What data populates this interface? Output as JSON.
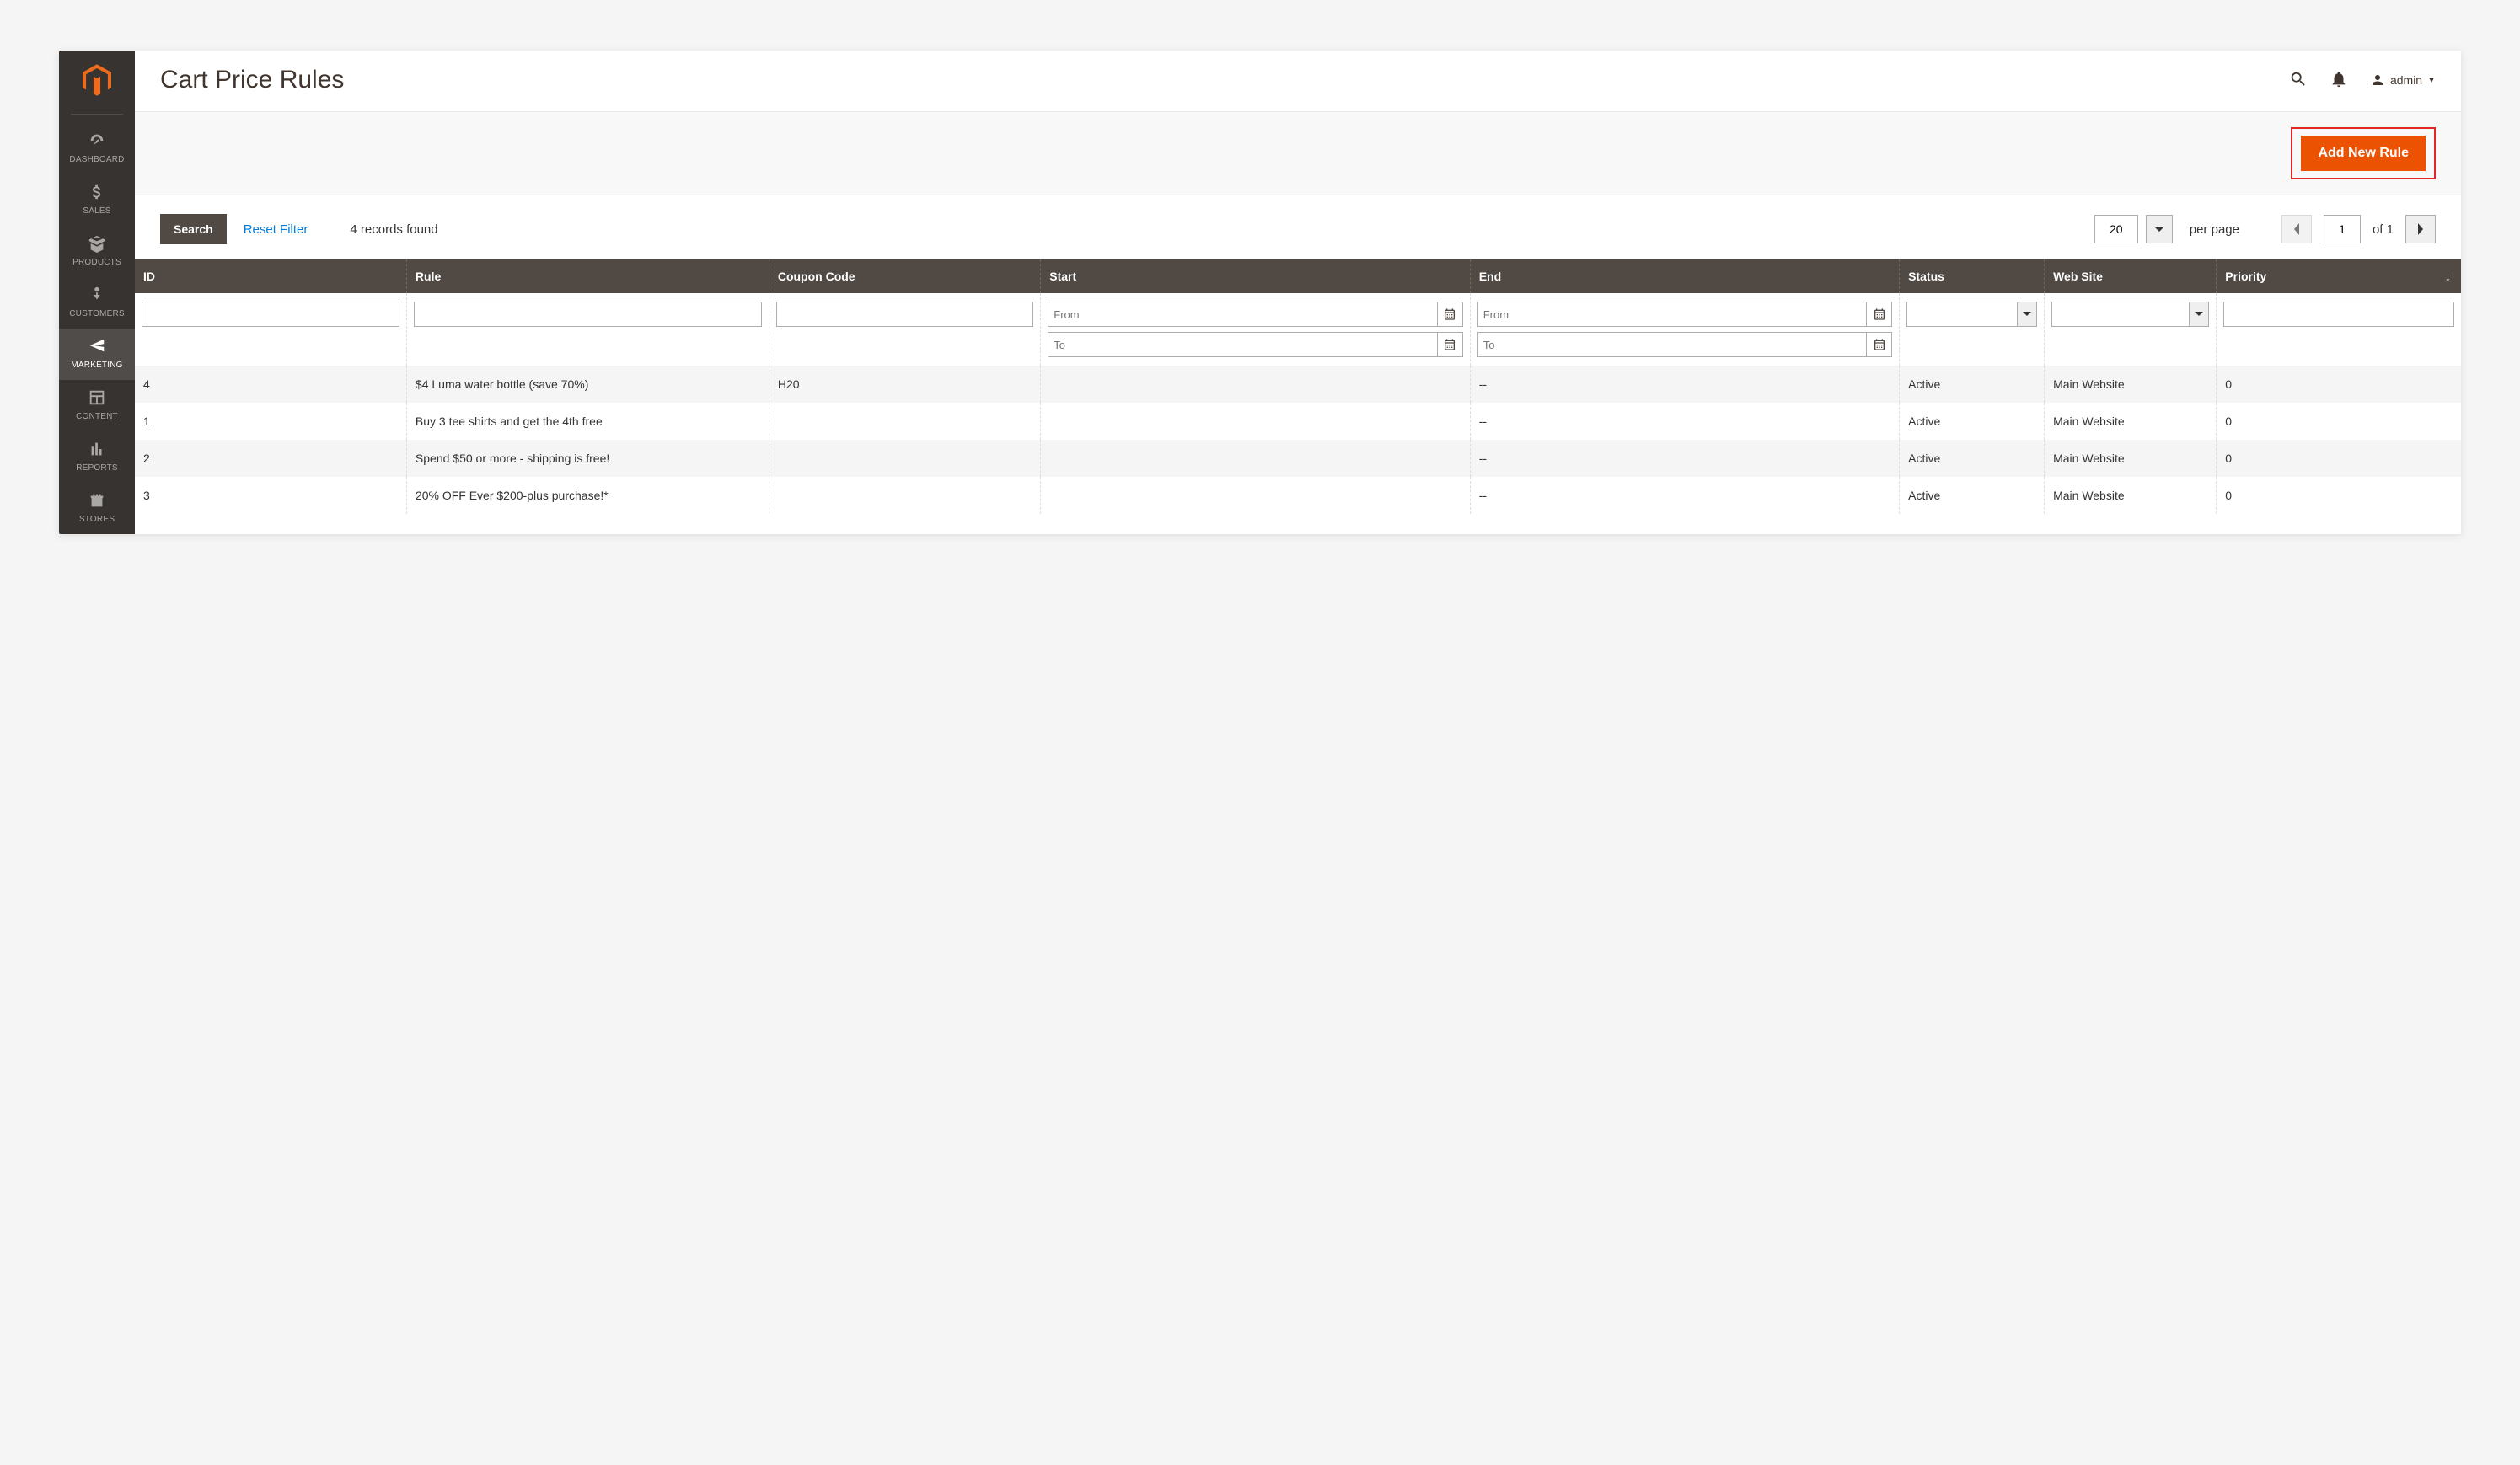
{
  "sidebar": {
    "items": [
      {
        "label": "DASHBOARD",
        "name": "nav-dashboard"
      },
      {
        "label": "SALES",
        "name": "nav-sales"
      },
      {
        "label": "PRODUCTS",
        "name": "nav-products"
      },
      {
        "label": "CUSTOMERS",
        "name": "nav-customers"
      },
      {
        "label": "MARKETING",
        "name": "nav-marketing",
        "active": true
      },
      {
        "label": "CONTENT",
        "name": "nav-content"
      },
      {
        "label": "REPORTS",
        "name": "nav-reports"
      },
      {
        "label": "STORES",
        "name": "nav-stores"
      }
    ]
  },
  "header": {
    "title": "Cart Price Rules",
    "account_label": "admin"
  },
  "actionbar": {
    "add_button": "Add New Rule"
  },
  "toolbar": {
    "search_label": "Search",
    "reset_label": "Reset Filter",
    "records_found": "4 records found",
    "page_size": "20",
    "per_page_label": "per page",
    "current_page": "1",
    "of_label": "of 1"
  },
  "columns": {
    "id": "ID",
    "rule": "Rule",
    "coupon": "Coupon Code",
    "start": "Start",
    "end": "End",
    "status": "Status",
    "website": "Web Site",
    "priority": "Priority"
  },
  "filters": {
    "from_placeholder": "From",
    "to_placeholder": "To"
  },
  "rows": [
    {
      "id": "4",
      "rule": "$4 Luma water bottle (save 70%)",
      "coupon": "H20",
      "start": "",
      "end": "--",
      "status": "Active",
      "website": "Main Website",
      "priority": "0"
    },
    {
      "id": "1",
      "rule": "Buy 3 tee shirts and get the 4th free",
      "coupon": "",
      "start": "",
      "end": "--",
      "status": "Active",
      "website": "Main Website",
      "priority": "0"
    },
    {
      "id": "2",
      "rule": "Spend $50 or more - shipping is free!",
      "coupon": "",
      "start": "",
      "end": "--",
      "status": "Active",
      "website": "Main Website",
      "priority": "0"
    },
    {
      "id": "3",
      "rule": "20% OFF Ever $200-plus purchase!*",
      "coupon": "",
      "start": "",
      "end": "--",
      "status": "Active",
      "website": "Main Website",
      "priority": "0"
    }
  ]
}
